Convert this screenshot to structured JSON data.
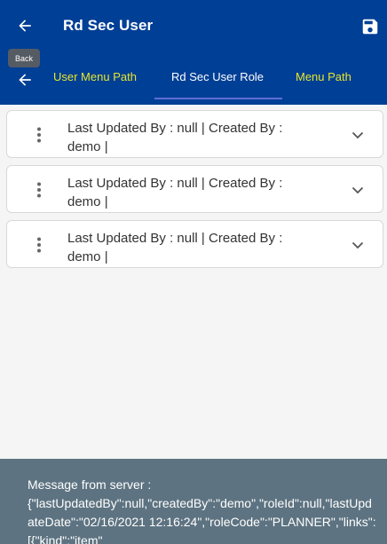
{
  "header": {
    "title": "Rd Sec User",
    "back_tooltip": "Back"
  },
  "tabs": [
    {
      "label": "User Menu Path"
    },
    {
      "label": "Rd Sec User Role"
    },
    {
      "label": "Menu Path"
    }
  ],
  "cards": [
    {
      "line1": "Last Updated By  : null | Created By  :",
      "line2": "demo |"
    },
    {
      "line1": "Last Updated By  : null | Created By  :",
      "line2": "demo |"
    },
    {
      "line1": "Last Updated By  : null | Created By  :",
      "line2": "demo |"
    }
  ],
  "toast": {
    "text": "Message from server :\n{\"lastUpdatedBy\":null,\"createdBy\":\"demo\",\"roleId\":null,\"lastUpdateDate\":\"02/16/2021 12:16:24\",\"roleCode\":\"PLANNER\",\"links\":[{\"kind\":\"item\""
  },
  "colors": {
    "appbar": "#003f96",
    "tab_inactive": "#e6e62a",
    "tab_active": "#ffffff",
    "toast_bg": "#5d7381"
  },
  "icons": {
    "back": "arrow-left-icon",
    "save": "floppy-disk-icon",
    "menu": "vertical-dots-icon",
    "expand": "chevron-down-icon"
  }
}
